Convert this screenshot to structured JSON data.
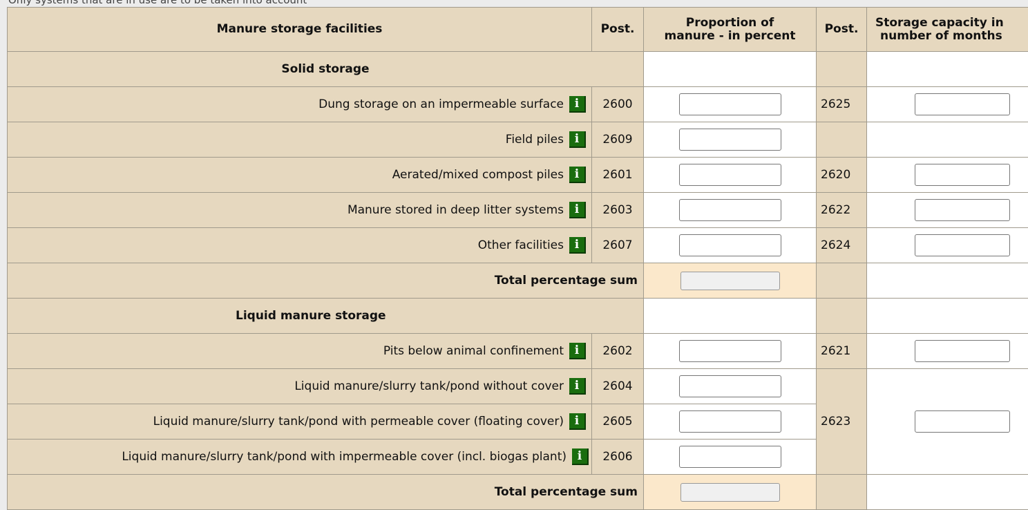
{
  "top_note": "Only systems that are in use are to be taken into account",
  "header": {
    "facilities": "Manure storage facilities",
    "post": "Post.",
    "proportion_line1": "Proportion of",
    "proportion_line2": "manure - in percent",
    "post2": "Post.",
    "capacity_line1": "Storage capacity in",
    "capacity_line2": "number of months"
  },
  "solid": {
    "title": "Solid storage",
    "rows": [
      {
        "label": "Dung storage on an impermeable surface",
        "post": "2600",
        "post2": "2625"
      },
      {
        "label": "Field piles",
        "post": "2609",
        "post2": ""
      },
      {
        "label": "Aerated/mixed compost piles",
        "post": "2601",
        "post2": "2620"
      },
      {
        "label": "Manure stored in deep litter systems",
        "post": "2603",
        "post2": "2622"
      },
      {
        "label": "Other facilities",
        "post": "2607",
        "post2": "2624"
      }
    ],
    "total_label": "Total percentage sum"
  },
  "liquid": {
    "title": "Liquid manure storage",
    "rows": [
      {
        "label": "Pits below animal confinement",
        "post": "2602",
        "post2": "2621"
      },
      {
        "label": "Liquid manure/slurry tank/pond without cover",
        "post": "2604"
      },
      {
        "label": "Liquid manure/slurry tank/pond with permeable cover (floating cover)",
        "post": "2605"
      },
      {
        "label": "Liquid manure/slurry tank/pond with impermeable cover (incl. biogas plant)",
        "post": "2606"
      }
    ],
    "shared_post2": "2623",
    "total_label": "Total percentage sum"
  },
  "info_icon": {
    "glyph": "i",
    "color": "#1a6d0f"
  },
  "colors": {
    "beige": "#e6d8bf",
    "sum_cell": "#fbe8cb",
    "white": "#ffffff"
  }
}
